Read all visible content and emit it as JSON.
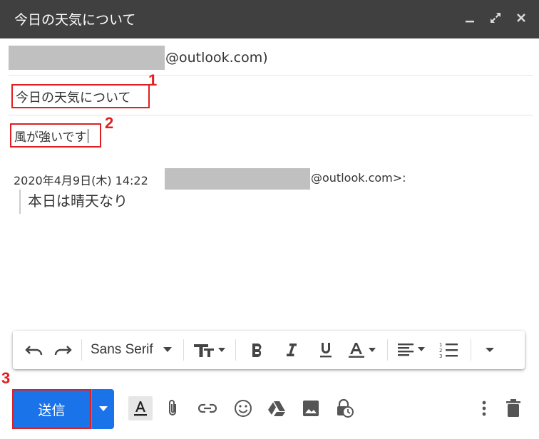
{
  "window": {
    "title": "今日の天気について",
    "controls": [
      "minimize-icon",
      "expand-icon",
      "close-icon"
    ]
  },
  "compose": {
    "to_suffix": "@outlook.com)",
    "subject": "今日の天気について",
    "body": "風が強いです",
    "quote_header_prefix": "2020年4月9日(木) 14:22",
    "quote_header_suffix": "@outlook.com>:",
    "quote_text": "本日は晴天なり"
  },
  "callouts": {
    "subject": "1",
    "body": "2",
    "send": "3"
  },
  "toolbar": {
    "font": "Sans Serif",
    "icons": [
      "undo-icon",
      "redo-icon",
      "font-size-icon",
      "bold-icon",
      "italic-icon",
      "underline-icon",
      "text-color-icon",
      "align-icon",
      "numbered-list-icon",
      "more-options-icon"
    ]
  },
  "bottom": {
    "send_label": "送信",
    "icons": [
      "formatting-icon",
      "attach-icon",
      "link-icon",
      "emoji-icon",
      "drive-icon",
      "photo-icon",
      "confidential-icon",
      "more-vert-icon",
      "trash-icon"
    ]
  },
  "colors": {
    "titlebar": "#404040",
    "accent": "#1a73e8",
    "callout": "#e02020",
    "redaction": "#c0c0c0"
  }
}
